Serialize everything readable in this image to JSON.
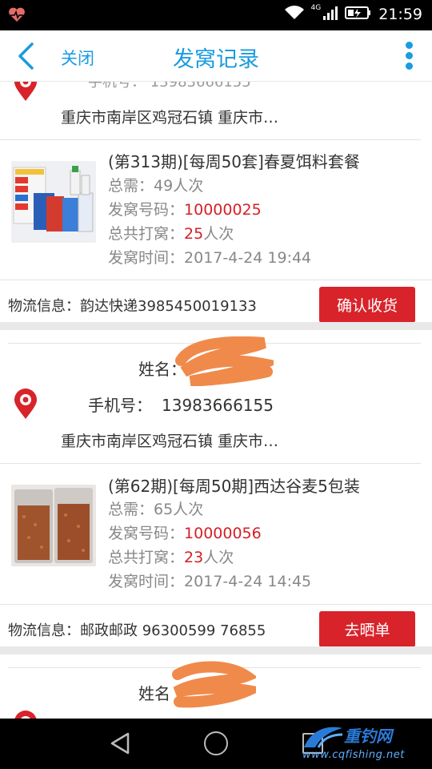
{
  "status_bar": {
    "time": "21:59",
    "network": "4G",
    "icons": [
      "heart-rate-icon",
      "wifi-icon",
      "signal-icon",
      "battery-charging-icon"
    ]
  },
  "header": {
    "close_label": "关闭",
    "title": "发窝记录"
  },
  "top_partial": {
    "address": "重庆市南岸区鸡冠石镇 重庆市…"
  },
  "orders": [
    {
      "product_title": "(第313期)[每周50套]春夏饵料套餐",
      "total_label": "总需：",
      "total_value": "49人次",
      "code_label": "发窝号码：",
      "code_value": "10000025",
      "times_label": "总共打窝：",
      "times_value": "25",
      "times_unit": "人次",
      "time_label": "发窝时间：",
      "time_value": "2017-4-24 19:44",
      "logistics_label": "物流信息：",
      "logistics_value": "韵达快递3985450019133",
      "action_label": "确认收货"
    },
    {
      "name_label": "姓名：",
      "phone_label": "手机号：",
      "phone_value": "13983666155",
      "address": "重庆市南岸区鸡冠石镇 重庆市…",
      "product_title": "(第62期)[每周50期]西达谷麦5包装",
      "total_label": "总需：",
      "total_value": "65人次",
      "code_label": "发窝号码：",
      "code_value": "10000056",
      "times_label": "总共打窝：",
      "times_value": "23",
      "times_unit": "人次",
      "time_label": "发窝时间：",
      "time_value": "2017-4-24 14:45",
      "logistics_label": "物流信息：",
      "logistics_value": "邮政邮政 96300599 76855",
      "action_label": "去晒单"
    },
    {
      "name_label": "姓名"
    }
  ],
  "watermark": {
    "name": "重钓网",
    "url": "www.cqfishing.net"
  },
  "colors": {
    "accent": "#1b9be0",
    "button": "#d8232a",
    "highlight_red": "#d51f25",
    "scribble": "#f08a4b"
  }
}
